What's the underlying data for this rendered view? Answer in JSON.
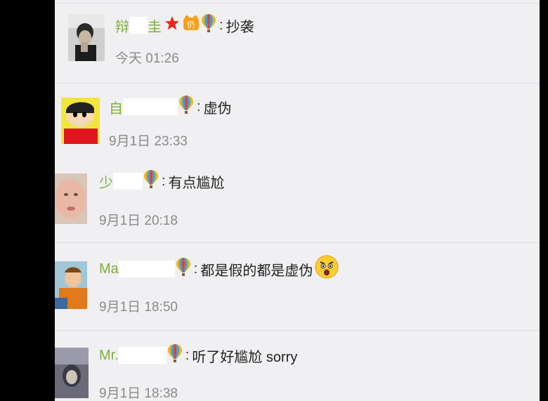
{
  "comments": [
    {
      "name_visible": "辩",
      "name_visible_end": "圭",
      "text": "抄袭",
      "time": "今天 01:26"
    },
    {
      "name_visible": "自",
      "text": "虚伪",
      "time": "9月1日 23:33"
    },
    {
      "name_visible": "少",
      "text": "有点尴尬",
      "time": "9月1日 20:18"
    },
    {
      "name_visible": "Ma",
      "text": "都是假的都是虚伪",
      "time": "9月1日 18:50"
    },
    {
      "name_visible": "Mr.",
      "text": "听了好尴尬 sorry",
      "time": "9月1日 18:38"
    }
  ],
  "icons": {
    "balloon": "hot-air-balloon-icon",
    "star": "red-star-icon",
    "fan_badge": "fan-badge-icon",
    "emoji": "shocked-face-emoji"
  },
  "colors": {
    "username": "#7fae3a",
    "timestamp": "#8a8a8a",
    "background": "#f0f0f3"
  }
}
